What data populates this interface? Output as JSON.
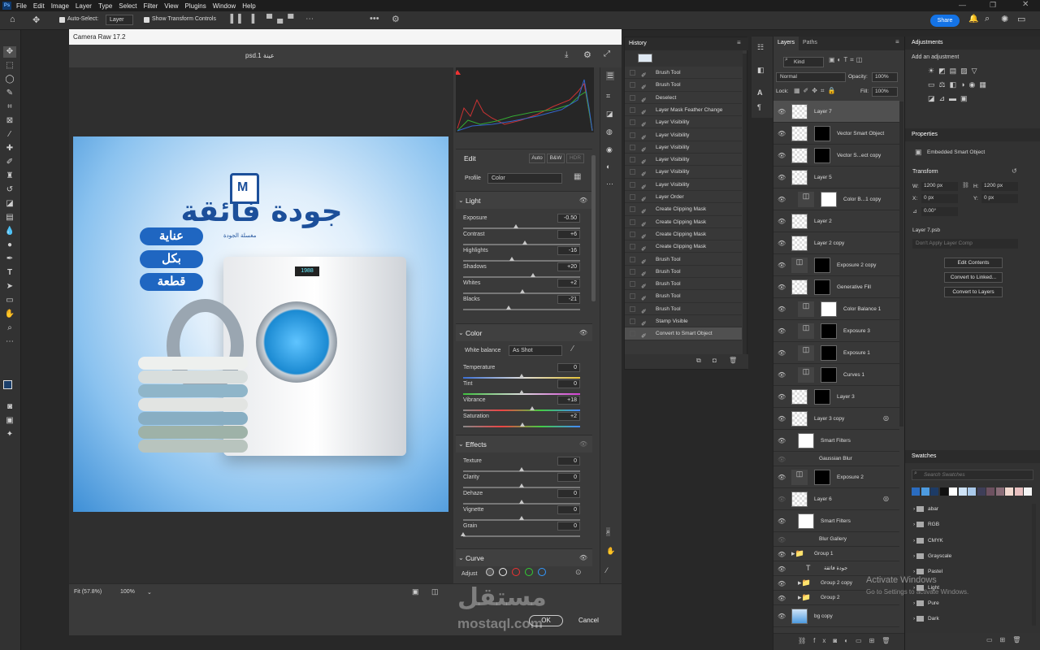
{
  "app": {
    "logo": "Ps",
    "menu": [
      "File",
      "Edit",
      "Image",
      "Layer",
      "Type",
      "Select",
      "Filter",
      "View",
      "Plugins",
      "Window",
      "Help"
    ],
    "share": "Share"
  },
  "options": {
    "auto_select": "Auto-Select:",
    "auto_select_value": "Layer",
    "transform_controls": "Show Transform Controls"
  },
  "camera_raw": {
    "title": "Camera Raw 17.2",
    "filename": "عينة 1.psd",
    "edit": "Edit",
    "auto": "Auto",
    "bw": "B&W",
    "hdr": "HDR",
    "profile_label": "Profile",
    "profile_value": "Color",
    "light": {
      "title": "Light",
      "sliders": [
        {
          "label": "Exposure",
          "value": "-0.50",
          "pos": 0.45
        },
        {
          "label": "Contrast",
          "value": "+6",
          "pos": 0.53
        },
        {
          "label": "Highlights",
          "value": "-16",
          "pos": 0.42
        },
        {
          "label": "Shadows",
          "value": "+20",
          "pos": 0.6
        },
        {
          "label": "Whites",
          "value": "+2",
          "pos": 0.51
        },
        {
          "label": "Blacks",
          "value": "-21",
          "pos": 0.39
        }
      ]
    },
    "color": {
      "title": "Color",
      "wb_label": "White balance",
      "wb_value": "As Shot",
      "sliders": [
        {
          "label": "Temperature",
          "value": "0",
          "pos": 0.5
        },
        {
          "label": "Tint",
          "value": "0",
          "pos": 0.5
        },
        {
          "label": "Vibrance",
          "value": "+18",
          "pos": 0.59
        },
        {
          "label": "Saturation",
          "value": "+2",
          "pos": 0.51
        }
      ]
    },
    "effects": {
      "title": "Effects",
      "sliders": [
        {
          "label": "Texture",
          "value": "0",
          "pos": 0.5
        },
        {
          "label": "Clarity",
          "value": "0",
          "pos": 0.5
        },
        {
          "label": "Dehaze",
          "value": "0",
          "pos": 0.5
        },
        {
          "label": "Vignette",
          "value": "0",
          "pos": 0.5
        },
        {
          "label": "Grain",
          "value": "0",
          "pos": 0.0
        }
      ]
    },
    "curve": {
      "title": "Curve",
      "adjust": "Adjust"
    },
    "zoom_fit": "Fit (57.8%)",
    "zoom_pct": "100%",
    "ok": "OK",
    "cancel": "Cancel"
  },
  "artwork": {
    "headline": "جودة فائقة",
    "brand": "مغسلة الجودة",
    "pills": [
      "عناية",
      "بكل",
      "قطعة"
    ],
    "display": "1988"
  },
  "history": {
    "title": "History",
    "items": [
      "Brush Tool",
      "Brush Tool",
      "Deselect",
      "Layer Mask Feather Change",
      "Layer Visibility",
      "Layer Visibility",
      "Layer Visibility",
      "Layer Visibility",
      "Layer Visibility",
      "Layer Visibility",
      "Layer Order",
      "Create Clipping Mask",
      "Create Clipping Mask",
      "Create Clipping Mask",
      "Create Clipping Mask",
      "Brush Tool",
      "Brush Tool",
      "Brush Tool",
      "Brush Tool",
      "Brush Tool",
      "Stamp Visible",
      "Convert to Smart Object"
    ]
  },
  "layers": {
    "tabs": [
      "Layers",
      "Paths"
    ],
    "kind": "Kind",
    "blend": "Normal",
    "opacity_label": "Opacity:",
    "opacity": "100%",
    "lock": "Lock:",
    "fill_label": "Fill:",
    "fill": "100%",
    "items": [
      "Layer 7",
      "Vector Smart Object",
      "Vector S...ect copy",
      "Layer 5",
      "Color B...1 copy",
      "Layer 2",
      "Layer 2 copy",
      "Exposure 2 copy",
      "Generative Fill",
      "Color Balance 1",
      "Exposure 3",
      "Exposure 1",
      "Curves 1",
      "Layer 3",
      "Layer 3 copy",
      "Smart Filters",
      "Gaussian Blur",
      "Exposure 2",
      "Layer 6",
      "Smart Filters",
      "Blur Gallery",
      "Group 1",
      "جودة فائقة",
      "Group 2 copy",
      "Group 2",
      "bg copy"
    ]
  },
  "adjustments": {
    "title": "Adjustments",
    "add": "Add an adjustment"
  },
  "properties": {
    "title": "Properties",
    "type": "Embedded Smart Object",
    "transform": "Transform",
    "w_label": "W:",
    "w": "1200 px",
    "h_label": "H:",
    "h": "1200 px",
    "x_label": "X:",
    "x": "0 px",
    "y_label": "Y:",
    "y": "0 px",
    "angle": "0.00°",
    "file": "Layer 7.psb",
    "comp": "Don't Apply Layer Comp",
    "buttons": [
      "Edit Contents",
      "Convert to Linked...",
      "Convert to Layers"
    ]
  },
  "swatches": {
    "title": "Swatches",
    "search": "Search Swatches",
    "colors": [
      "#2a6cc0",
      "#4d9be0",
      "#1d3b66",
      "#111111",
      "#ffffff",
      "#cfe3f7",
      "#a9c9ea",
      "#3e3e58",
      "#6d5160",
      "#8a6d78",
      "#f2d9d0",
      "#e8c0c0",
      "#f5f5f5"
    ],
    "folders": [
      "abar",
      "RGB",
      "CMYK",
      "Grayscale",
      "Pastel",
      "Light",
      "Pure",
      "Dark"
    ]
  },
  "watermark": {
    "activate": "Activate Windows",
    "goto": "Go to Settings to activate Windows.",
    "site": "mostaql.com",
    "brand": "مستقل"
  }
}
